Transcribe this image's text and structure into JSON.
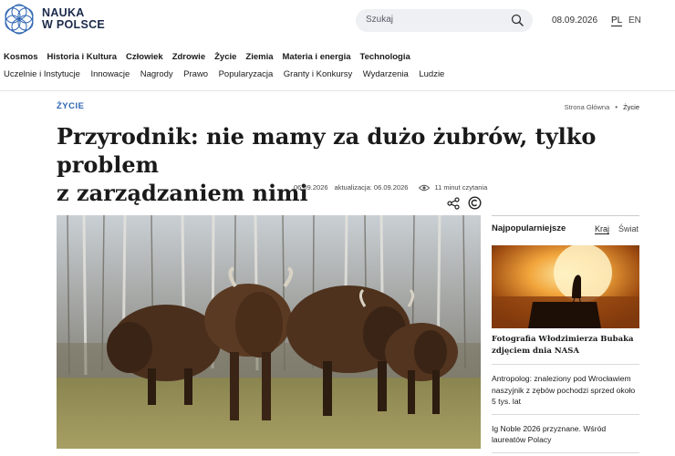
{
  "header": {
    "logo_line1": "NAUKA",
    "logo_line2": "W POLSCE",
    "search_placeholder": "Szukaj",
    "date": "08.09.2026",
    "lang_active": "PL",
    "lang_other": "EN"
  },
  "nav_primary": [
    "Kosmos",
    "Historia i Kultura",
    "Człowiek",
    "Zdrowie",
    "Życie",
    "Ziemia",
    "Materia i energia",
    "Technologia"
  ],
  "nav_secondary": [
    "Uczelnie i Instytucje",
    "Innowacje",
    "Nagrody",
    "Prawo",
    "Popularyzacja",
    "Granty i Konkursy",
    "Wydarzenia",
    "Ludzie"
  ],
  "article": {
    "category": "ŻYCIE",
    "breadcrumb": {
      "home": "Strona Główna",
      "current": "Życie"
    },
    "title_line1": "Przyrodnik: nie mamy za dużo żubrów, tylko problem",
    "title_line2": "z zarządzaniem nimi",
    "published": "06.09.2026",
    "updated": "aktualizacja: 06.09.2026",
    "reading_time": "11 minut czytania"
  },
  "sidebar": {
    "title": "Najpopularniejsze",
    "tab_active": "Kraj",
    "tab_other": "Świat",
    "featured": "Fotografia Włodzimierza Bubaka zdjęciem dnia NASA",
    "items": [
      "Antropolog: znaleziony pod Wrocławiem naszyjnik z zębów pochodzi sprzed około 5 tys. lat",
      "Ig Noble 2026 przyznane. Wśród laureatów Polacy"
    ]
  },
  "icons": [
    "logo-mark-icon",
    "search-icon",
    "share-icon",
    "copyright-icon",
    "eye-icon"
  ],
  "colors": {
    "accent": "#2f66b3",
    "brand": "#1b2a4a",
    "search_bg": "#eef0f3"
  }
}
